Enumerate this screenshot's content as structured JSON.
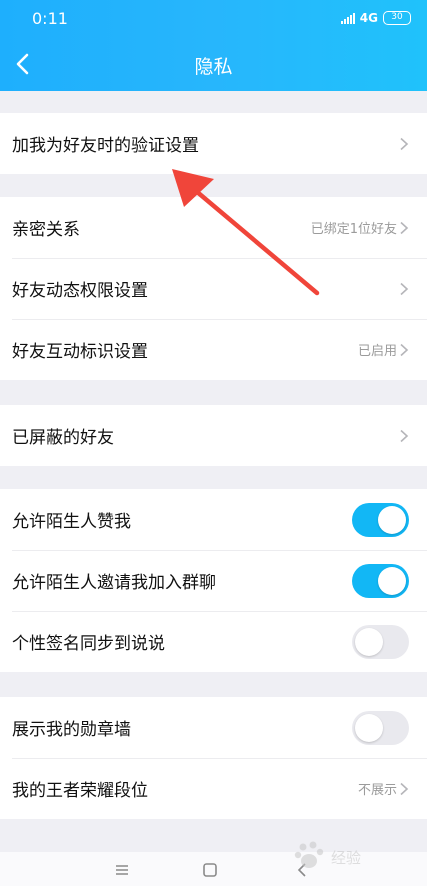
{
  "status_bar": {
    "time": "0:11",
    "network": "4G",
    "battery": "30"
  },
  "header": {
    "title": "隐私"
  },
  "groups": [
    {
      "rows": [
        {
          "label": "加我为好友时的验证设置",
          "value": ""
        }
      ]
    },
    {
      "rows": [
        {
          "label": "亲密关系",
          "value": "已绑定1位好友"
        },
        {
          "label": "好友动态权限设置",
          "value": ""
        },
        {
          "label": "好友互动标识设置",
          "value": "已启用"
        }
      ]
    },
    {
      "rows": [
        {
          "label": "已屏蔽的好友",
          "value": ""
        }
      ]
    },
    {
      "rows": [
        {
          "label": "允许陌生人赞我",
          "toggle": true
        },
        {
          "label": "允许陌生人邀请我加入群聊",
          "toggle": true
        },
        {
          "label": "个性签名同步到说说",
          "toggle": false
        }
      ]
    },
    {
      "rows": [
        {
          "label": "展示我的勋章墙",
          "toggle": false
        },
        {
          "label": "我的王者荣耀段位",
          "value": "不展示"
        }
      ]
    }
  ],
  "colors": {
    "accent": "#12b7f5",
    "header_start": "#1eaffd",
    "header_end": "#20c2fb",
    "annotation_arrow": "#f0453a"
  },
  "icons": {
    "back": "chevron-left-icon",
    "row_chevron": "chevron-right-icon",
    "nav_menu": "menu-icon",
    "nav_home": "home-square-icon",
    "nav_back": "back-triangle-icon"
  },
  "watermark": {
    "text": "经验"
  }
}
